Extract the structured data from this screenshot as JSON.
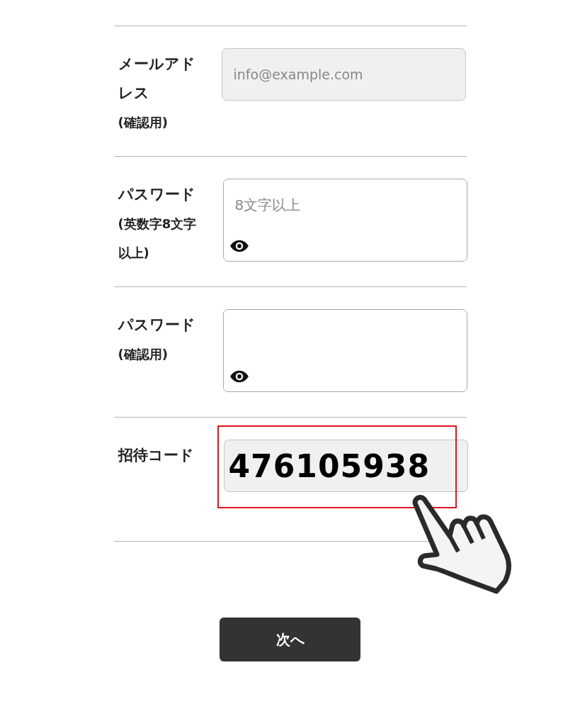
{
  "rows": [
    {
      "label": "メールアドレス",
      "sublabel": "(確認用)",
      "field": {
        "kind": "text",
        "placeholder": "info@example.com",
        "disabled": true
      }
    },
    {
      "label": "パスワード",
      "sublabel": "(英数字8文字以上)",
      "field": {
        "kind": "password",
        "placeholder": "8文字以上",
        "disabled": false
      }
    },
    {
      "label": "パスワード",
      "sublabel": "(確認用)",
      "field": {
        "kind": "password",
        "disabled": false
      }
    },
    {
      "label": "招待コード",
      "field": {
        "kind": "code",
        "value": "476105938",
        "disabled": true,
        "highlighted": true
      }
    }
  ],
  "next_button": "次へ"
}
